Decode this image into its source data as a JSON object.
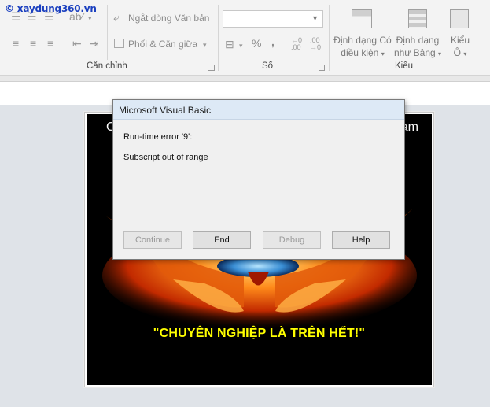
{
  "watermark": "xaydung360.vn",
  "ribbon": {
    "wrap_text": "Ngắt dòng Văn bản",
    "merge_center": "Phối & Căn giữa",
    "alignment_group": "Căn chỉnh",
    "number_group": "Số",
    "styles_group": "Kiểu",
    "percent_symbol": "%",
    "comma_symbol": ",",
    "conditional_format_l1": "Định dạng Có",
    "conditional_format_l2": "điều kiện",
    "format_table_l1": "Định dạng",
    "format_table_l2": "như Bảng",
    "cell_styles_l1": "Kiểu",
    "cell_styles_l2": "Ô",
    "number_format_value": ""
  },
  "picture": {
    "top_text_left": "C",
    "top_text_right": "am",
    "slogan": "\"CHUYÊN NGHIỆP LÀ TRÊN HẾT!\""
  },
  "dialog": {
    "title": "Microsoft Visual Basic",
    "error_line": "Run-time error '9':",
    "error_message": "Subscript out of range",
    "buttons": {
      "continue": "Continue",
      "end": "End",
      "debug": "Debug",
      "help": "Help"
    }
  }
}
